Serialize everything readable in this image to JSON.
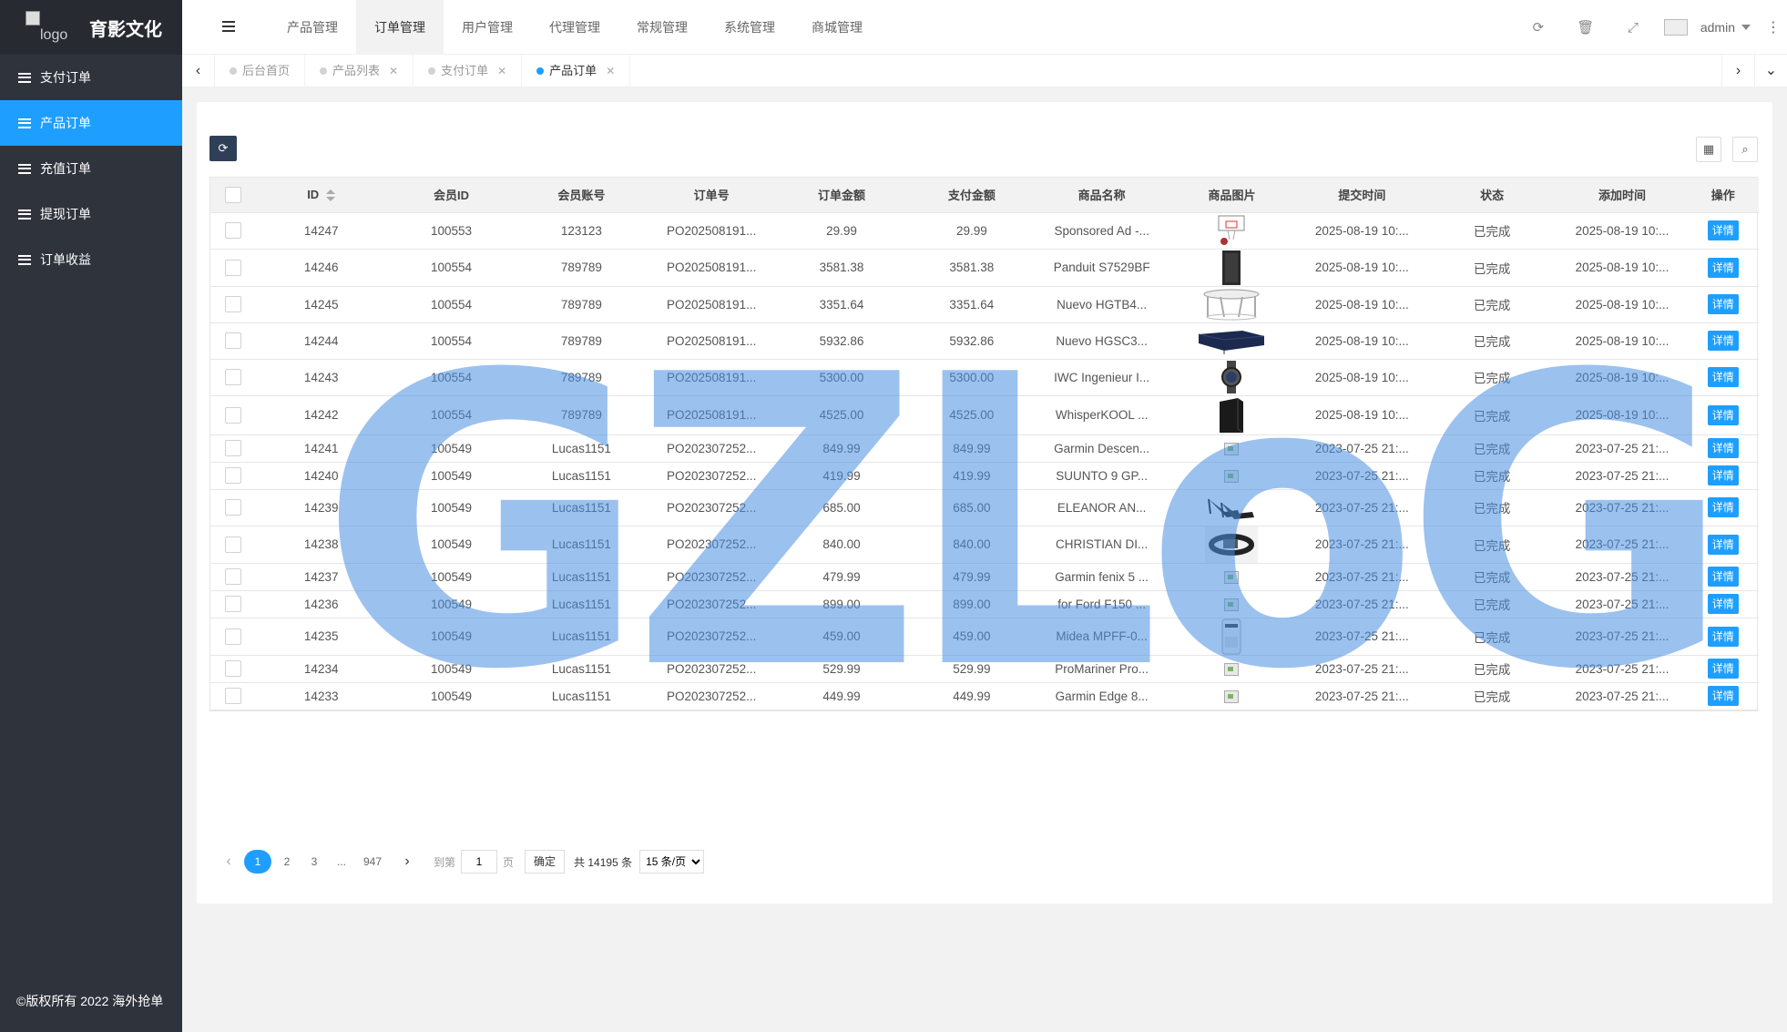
{
  "sidebar": {
    "logo_alt": "logo",
    "title": "育影文化",
    "items": [
      {
        "label": "支付订单"
      },
      {
        "label": "产品订单"
      },
      {
        "label": "充值订单"
      },
      {
        "label": "提现订单"
      },
      {
        "label": "订单收益"
      }
    ],
    "active_index": 1,
    "copyright": "©版权所有 2022 海外抢单"
  },
  "header": {
    "nav": [
      "产品管理",
      "订单管理",
      "用户管理",
      "代理管理",
      "常规管理",
      "系统管理",
      "商城管理"
    ],
    "active_nav": 1,
    "user": "admin"
  },
  "tabs": [
    {
      "label": "后台首页",
      "closable": false
    },
    {
      "label": "产品列表",
      "closable": true
    },
    {
      "label": "支付订单",
      "closable": true
    },
    {
      "label": "产品订单",
      "closable": true
    }
  ],
  "table": {
    "columns": [
      "ID",
      "会员ID",
      "会员账号",
      "订单号",
      "订单金额",
      "支付金额",
      "商品名称",
      "商品图片",
      "提交时间",
      "状态",
      "添加时间",
      "操作"
    ],
    "detail_label": "详情",
    "rows": [
      {
        "id": "14247",
        "member_id": "100553",
        "account": "123123",
        "order_no": "PO202508191...",
        "amount": "29.99",
        "paid": "29.99",
        "product": "Sponsored Ad -...",
        "img": "hoop",
        "submit": "2025-08-19 10:...",
        "status": "已完成",
        "added": "2025-08-19 10:..."
      },
      {
        "id": "14246",
        "member_id": "100554",
        "account": "789789",
        "order_no": "PO202508191...",
        "amount": "3581.38",
        "paid": "3581.38",
        "product": "Panduit S7529BF",
        "img": "cabinet",
        "submit": "2025-08-19 10:...",
        "status": "已完成",
        "added": "2025-08-19 10:..."
      },
      {
        "id": "14245",
        "member_id": "100554",
        "account": "789789",
        "order_no": "PO202508191...",
        "amount": "3351.64",
        "paid": "3351.64",
        "product": "Nuevo HGTB4...",
        "img": "table",
        "submit": "2025-08-19 10:...",
        "status": "已完成",
        "added": "2025-08-19 10:..."
      },
      {
        "id": "14244",
        "member_id": "100554",
        "account": "789789",
        "order_no": "PO202508191...",
        "amount": "5932.86",
        "paid": "5932.86",
        "product": "Nuevo HGSC3...",
        "img": "sofa",
        "submit": "2025-08-19 10:...",
        "status": "已完成",
        "added": "2025-08-19 10:..."
      },
      {
        "id": "14243",
        "member_id": "100554",
        "account": "789789",
        "order_no": "PO202508191...",
        "amount": "5300.00",
        "paid": "5300.00",
        "product": "IWC Ingenieur I...",
        "img": "watch",
        "submit": "2025-08-19 10:...",
        "status": "已完成",
        "added": "2025-08-19 10:..."
      },
      {
        "id": "14242",
        "member_id": "100554",
        "account": "789789",
        "order_no": "PO202508191...",
        "amount": "4525.00",
        "paid": "4525.00",
        "product": "WhisperKOOL ...",
        "img": "box",
        "submit": "2025-08-19 10:...",
        "status": "已完成",
        "added": "2025-08-19 10:..."
      },
      {
        "id": "14241",
        "member_id": "100549",
        "account": "Lucas1151",
        "order_no": "PO202307252...",
        "amount": "849.99",
        "paid": "849.99",
        "product": "Garmin Descen...",
        "img": "broken",
        "submit": "2023-07-25 21:...",
        "status": "已完成",
        "added": "2023-07-25 21:..."
      },
      {
        "id": "14240",
        "member_id": "100549",
        "account": "Lucas1151",
        "order_no": "PO202307252...",
        "amount": "419.99",
        "paid": "419.99",
        "product": "SUUNTO 9 GP...",
        "img": "broken",
        "submit": "2023-07-25 21:...",
        "status": "已完成",
        "added": "2023-07-25 21:..."
      },
      {
        "id": "14239",
        "member_id": "100549",
        "account": "Lucas1151",
        "order_no": "PO202307252...",
        "amount": "685.00",
        "paid": "685.00",
        "product": "ELEANOR AN...",
        "img": "shoes",
        "submit": "2023-07-25 21:...",
        "status": "已完成",
        "added": "2023-07-25 21:..."
      },
      {
        "id": "14238",
        "member_id": "100549",
        "account": "Lucas1151",
        "order_no": "PO202307252...",
        "amount": "840.00",
        "paid": "840.00",
        "product": "CHRISTIAN DI...",
        "img": "belt",
        "submit": "2023-07-25 21:...",
        "status": "已完成",
        "added": "2023-07-25 21:..."
      },
      {
        "id": "14237",
        "member_id": "100549",
        "account": "Lucas1151",
        "order_no": "PO202307252...",
        "amount": "479.99",
        "paid": "479.99",
        "product": "Garmin fenix 5 ...",
        "img": "broken",
        "submit": "2023-07-25 21:...",
        "status": "已完成",
        "added": "2023-07-25 21:..."
      },
      {
        "id": "14236",
        "member_id": "100549",
        "account": "Lucas1151",
        "order_no": "PO202307252...",
        "amount": "899.00",
        "paid": "899.00",
        "product": "for Ford F150 ...",
        "img": "broken",
        "submit": "2023-07-25 21:...",
        "status": "已完成",
        "added": "2023-07-25 21:..."
      },
      {
        "id": "14235",
        "member_id": "100549",
        "account": "Lucas1151",
        "order_no": "PO202307252...",
        "amount": "459.00",
        "paid": "459.00",
        "product": "Midea MPFF-0...",
        "img": "ac",
        "submit": "2023-07-25 21:...",
        "status": "已完成",
        "added": "2023-07-25 21:..."
      },
      {
        "id": "14234",
        "member_id": "100549",
        "account": "Lucas1151",
        "order_no": "PO202307252...",
        "amount": "529.99",
        "paid": "529.99",
        "product": "ProMariner Pro...",
        "img": "broken",
        "submit": "2023-07-25 21:...",
        "status": "已完成",
        "added": "2023-07-25 21:..."
      },
      {
        "id": "14233",
        "member_id": "100549",
        "account": "Lucas1151",
        "order_no": "PO202307252...",
        "amount": "449.99",
        "paid": "449.99",
        "product": "Garmin Edge 8...",
        "img": "broken",
        "submit": "2023-07-25 21:...",
        "status": "已完成",
        "added": "2023-07-25 21:..."
      }
    ]
  },
  "pager": {
    "pages": [
      "1",
      "2",
      "3"
    ],
    "ellipsis": "...",
    "last": "947",
    "goto_label": "到第",
    "page_input": "1",
    "page_unit": "页",
    "confirm": "确定",
    "total": "共 14195 条",
    "size_option": "15 条/页"
  },
  "watermark": "GZLoG",
  "colors": {
    "accent": "#1e9fff",
    "sidebar": "#2f333c",
    "watermark": "#4a90e2"
  }
}
